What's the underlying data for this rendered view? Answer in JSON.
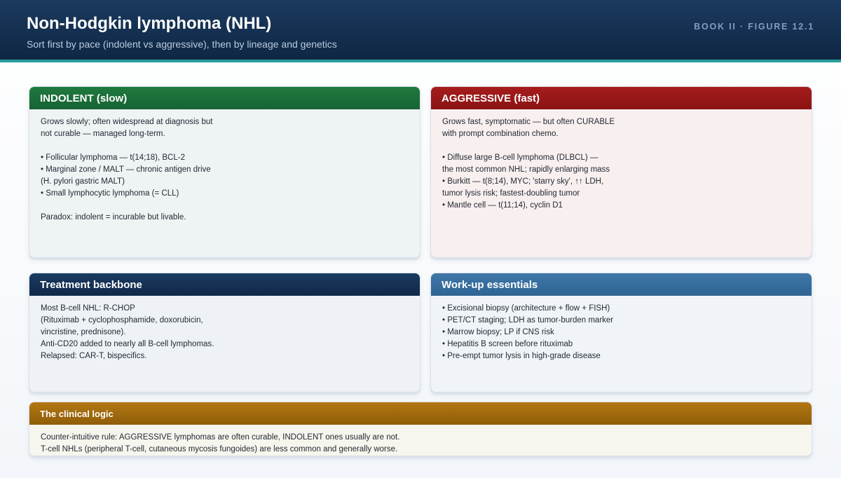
{
  "header": {
    "title": "Non-Hodgkin lymphoma (NHL)",
    "subtitle": "Sort first by pace (indolent vs aggressive), then by lineage and genetics",
    "figure_tag": "BOOK II · FIGURE 12.1"
  },
  "colors": {
    "header_bg": "#14304f",
    "accent_rule": "#2a9d9b",
    "indolent": "#1f7a3f",
    "aggressive": "#a61c1c",
    "treatment": "#1a3a60",
    "workup": "#3f77a8",
    "logic": "#b27712"
  },
  "cards": {
    "indolent": {
      "title": "INDOLENT (slow)",
      "lines": [
        "Grows slowly; often widespread at diagnosis but",
        "not curable — managed long-term.",
        "",
        "• Follicular lymphoma — t(14;18), BCL-2",
        "• Marginal zone / MALT — chronic antigen drive",
        "(H. pylori gastric MALT)",
        "• Small lymphocytic lymphoma (= CLL)",
        "",
        "Paradox: indolent = incurable but livable."
      ]
    },
    "aggressive": {
      "title": "AGGRESSIVE (fast)",
      "lines": [
        "Grows fast, symptomatic — but often CURABLE",
        "with prompt combination chemo.",
        "",
        "• Diffuse large B-cell lymphoma (DLBCL) —",
        "the most common NHL; rapidly enlarging mass",
        "• Burkitt — t(8;14), MYC; 'starry sky', ↑↑ LDH,",
        "tumor lysis risk; fastest-doubling tumor",
        "• Mantle cell — t(11;14), cyclin D1"
      ]
    },
    "treatment": {
      "title": "Treatment backbone",
      "lines": [
        "Most B-cell NHL: R-CHOP",
        "(Rituximab + cyclophosphamide, doxorubicin,",
        "vincristine, prednisone).",
        "Anti-CD20 added to nearly all B-cell lymphomas.",
        "Relapsed: CAR-T, bispecifics."
      ]
    },
    "workup": {
      "title": "Work-up essentials",
      "lines": [
        "• Excisional biopsy (architecture + flow + FISH)",
        "• PET/CT staging; LDH as tumor-burden marker",
        "• Marrow biopsy; LP if CNS risk",
        "• Hepatitis B screen before rituximab",
        "• Pre-empt tumor lysis in high-grade disease"
      ]
    },
    "logic": {
      "title": "The clinical logic",
      "lines": [
        "Counter-intuitive rule: AGGRESSIVE lymphomas are often curable, INDOLENT ones usually are not.",
        "T-cell NHLs (peripheral T-cell, cutaneous mycosis fungoides) are less common and generally worse."
      ]
    }
  }
}
